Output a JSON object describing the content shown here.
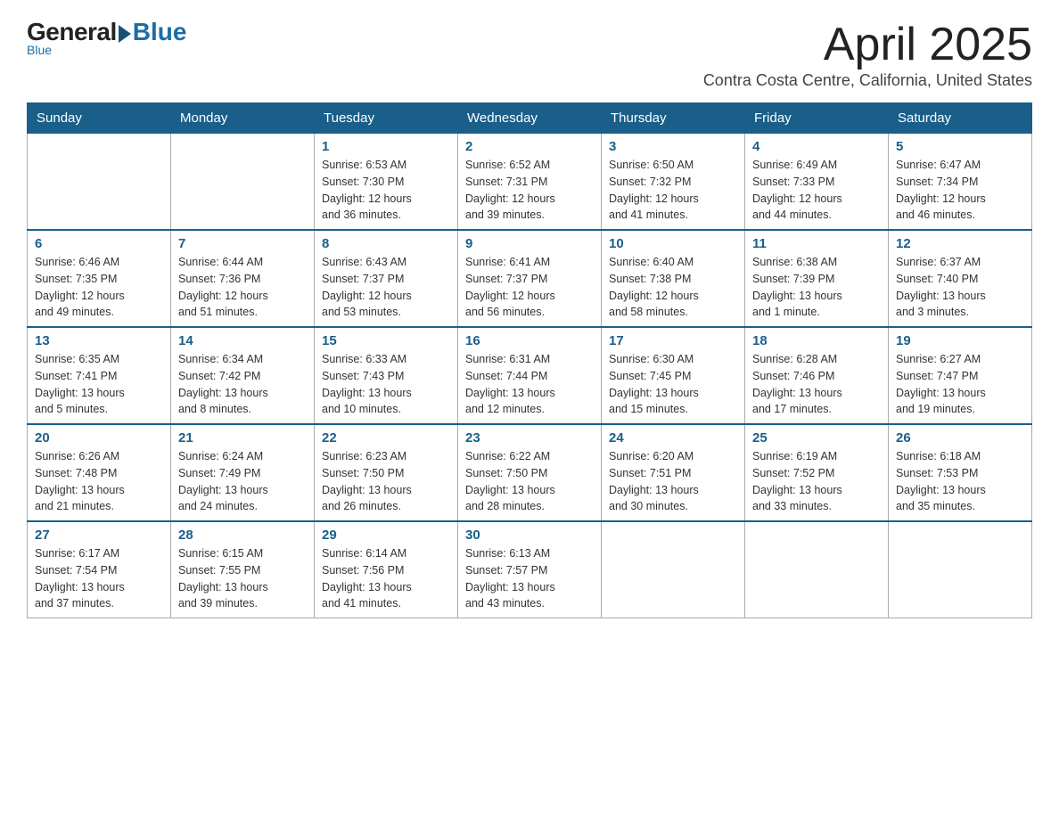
{
  "header": {
    "logo_general": "General",
    "logo_blue": "Blue",
    "month_title": "April 2025",
    "subtitle": "Contra Costa Centre, California, United States"
  },
  "days_of_week": [
    "Sunday",
    "Monday",
    "Tuesday",
    "Wednesday",
    "Thursday",
    "Friday",
    "Saturday"
  ],
  "weeks": [
    [
      {
        "day": "",
        "info": ""
      },
      {
        "day": "",
        "info": ""
      },
      {
        "day": "1",
        "info": "Sunrise: 6:53 AM\nSunset: 7:30 PM\nDaylight: 12 hours\nand 36 minutes."
      },
      {
        "day": "2",
        "info": "Sunrise: 6:52 AM\nSunset: 7:31 PM\nDaylight: 12 hours\nand 39 minutes."
      },
      {
        "day": "3",
        "info": "Sunrise: 6:50 AM\nSunset: 7:32 PM\nDaylight: 12 hours\nand 41 minutes."
      },
      {
        "day": "4",
        "info": "Sunrise: 6:49 AM\nSunset: 7:33 PM\nDaylight: 12 hours\nand 44 minutes."
      },
      {
        "day": "5",
        "info": "Sunrise: 6:47 AM\nSunset: 7:34 PM\nDaylight: 12 hours\nand 46 minutes."
      }
    ],
    [
      {
        "day": "6",
        "info": "Sunrise: 6:46 AM\nSunset: 7:35 PM\nDaylight: 12 hours\nand 49 minutes."
      },
      {
        "day": "7",
        "info": "Sunrise: 6:44 AM\nSunset: 7:36 PM\nDaylight: 12 hours\nand 51 minutes."
      },
      {
        "day": "8",
        "info": "Sunrise: 6:43 AM\nSunset: 7:37 PM\nDaylight: 12 hours\nand 53 minutes."
      },
      {
        "day": "9",
        "info": "Sunrise: 6:41 AM\nSunset: 7:37 PM\nDaylight: 12 hours\nand 56 minutes."
      },
      {
        "day": "10",
        "info": "Sunrise: 6:40 AM\nSunset: 7:38 PM\nDaylight: 12 hours\nand 58 minutes."
      },
      {
        "day": "11",
        "info": "Sunrise: 6:38 AM\nSunset: 7:39 PM\nDaylight: 13 hours\nand 1 minute."
      },
      {
        "day": "12",
        "info": "Sunrise: 6:37 AM\nSunset: 7:40 PM\nDaylight: 13 hours\nand 3 minutes."
      }
    ],
    [
      {
        "day": "13",
        "info": "Sunrise: 6:35 AM\nSunset: 7:41 PM\nDaylight: 13 hours\nand 5 minutes."
      },
      {
        "day": "14",
        "info": "Sunrise: 6:34 AM\nSunset: 7:42 PM\nDaylight: 13 hours\nand 8 minutes."
      },
      {
        "day": "15",
        "info": "Sunrise: 6:33 AM\nSunset: 7:43 PM\nDaylight: 13 hours\nand 10 minutes."
      },
      {
        "day": "16",
        "info": "Sunrise: 6:31 AM\nSunset: 7:44 PM\nDaylight: 13 hours\nand 12 minutes."
      },
      {
        "day": "17",
        "info": "Sunrise: 6:30 AM\nSunset: 7:45 PM\nDaylight: 13 hours\nand 15 minutes."
      },
      {
        "day": "18",
        "info": "Sunrise: 6:28 AM\nSunset: 7:46 PM\nDaylight: 13 hours\nand 17 minutes."
      },
      {
        "day": "19",
        "info": "Sunrise: 6:27 AM\nSunset: 7:47 PM\nDaylight: 13 hours\nand 19 minutes."
      }
    ],
    [
      {
        "day": "20",
        "info": "Sunrise: 6:26 AM\nSunset: 7:48 PM\nDaylight: 13 hours\nand 21 minutes."
      },
      {
        "day": "21",
        "info": "Sunrise: 6:24 AM\nSunset: 7:49 PM\nDaylight: 13 hours\nand 24 minutes."
      },
      {
        "day": "22",
        "info": "Sunrise: 6:23 AM\nSunset: 7:50 PM\nDaylight: 13 hours\nand 26 minutes."
      },
      {
        "day": "23",
        "info": "Sunrise: 6:22 AM\nSunset: 7:50 PM\nDaylight: 13 hours\nand 28 minutes."
      },
      {
        "day": "24",
        "info": "Sunrise: 6:20 AM\nSunset: 7:51 PM\nDaylight: 13 hours\nand 30 minutes."
      },
      {
        "day": "25",
        "info": "Sunrise: 6:19 AM\nSunset: 7:52 PM\nDaylight: 13 hours\nand 33 minutes."
      },
      {
        "day": "26",
        "info": "Sunrise: 6:18 AM\nSunset: 7:53 PM\nDaylight: 13 hours\nand 35 minutes."
      }
    ],
    [
      {
        "day": "27",
        "info": "Sunrise: 6:17 AM\nSunset: 7:54 PM\nDaylight: 13 hours\nand 37 minutes."
      },
      {
        "day": "28",
        "info": "Sunrise: 6:15 AM\nSunset: 7:55 PM\nDaylight: 13 hours\nand 39 minutes."
      },
      {
        "day": "29",
        "info": "Sunrise: 6:14 AM\nSunset: 7:56 PM\nDaylight: 13 hours\nand 41 minutes."
      },
      {
        "day": "30",
        "info": "Sunrise: 6:13 AM\nSunset: 7:57 PM\nDaylight: 13 hours\nand 43 minutes."
      },
      {
        "day": "",
        "info": ""
      },
      {
        "day": "",
        "info": ""
      },
      {
        "day": "",
        "info": ""
      }
    ]
  ]
}
